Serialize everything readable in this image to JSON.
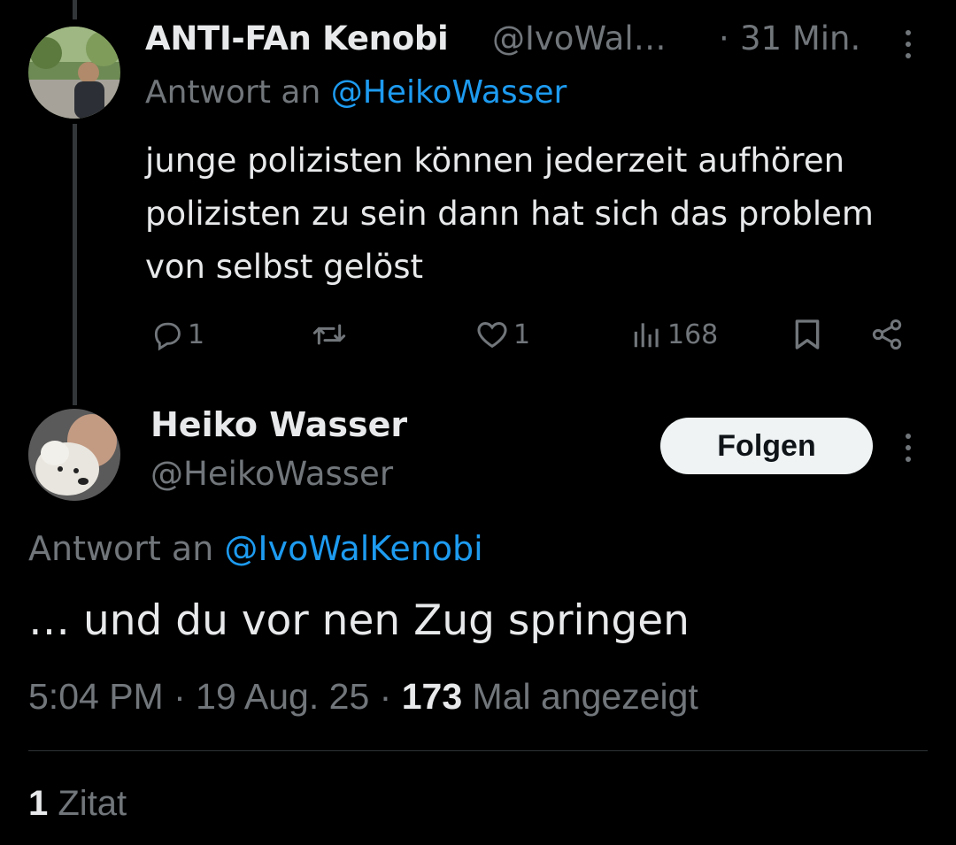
{
  "reply_tweet": {
    "author_name": "ANTI-FAn Kenobi",
    "author_handle": "@IvoWal…",
    "time_separator": "·",
    "time_ago": "31 Min.",
    "reply_prefix": "Antwort an",
    "reply_to_handle": "@HeikoWasser",
    "text": "junge polizisten können jederzeit aufhören polizisten zu sein dann hat sich das problem von selbst gelöst",
    "actions": {
      "replies": "1",
      "retweets": "",
      "likes": "1",
      "views": "168"
    },
    "icons": {
      "reply": "comment-icon",
      "retweet": "retweet-icon",
      "like": "heart-icon",
      "views": "analytics-icon",
      "bookmark": "bookmark-icon",
      "share": "share-icon",
      "more": "more-vertical-icon"
    }
  },
  "main_tweet": {
    "author_name": "Heiko Wasser",
    "author_handle": "@HeikoWasser",
    "follow_label": "Folgen",
    "reply_prefix": "Antwort an",
    "reply_to_handle": "@IvoWalKenobi",
    "text": "… und du vor nen Zug springen",
    "time": "5:04 PM",
    "date": "19 Aug. 25",
    "separator": "·",
    "view_count": "173",
    "view_label": "Mal angezeigt"
  },
  "quotes": {
    "count": "1",
    "label": "Zitat"
  },
  "colors": {
    "background": "#000000",
    "primary_text": "#e7e9ea",
    "secondary_text": "#71767b",
    "link": "#1d9bf0",
    "follow_button_bg": "#eff3f4",
    "divider": "#2f3336"
  }
}
